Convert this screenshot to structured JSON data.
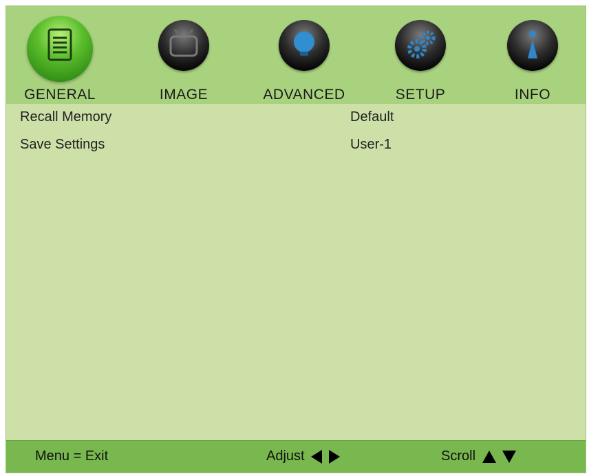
{
  "tabs": [
    {
      "label": "GENERAL",
      "icon": "document-icon",
      "active": true
    },
    {
      "label": "IMAGE",
      "icon": "tv-icon",
      "active": false
    },
    {
      "label": "ADVANCED",
      "icon": "lightbulb-icon",
      "active": false
    },
    {
      "label": "SETUP",
      "icon": "gears-icon",
      "active": false
    },
    {
      "label": "INFO",
      "icon": "info-icon",
      "active": false
    }
  ],
  "menu": {
    "items": [
      {
        "label": "Recall Memory",
        "value": "Default"
      },
      {
        "label": "Save Settings",
        "value": "User-1"
      }
    ]
  },
  "footer": {
    "menu_hint": "Menu = Exit",
    "adjust_hint": "Adjust",
    "scroll_hint": "Scroll"
  },
  "colors": {
    "tabbar_bg": "#a9d27f",
    "panel_bg": "#cde0a8",
    "footer_bg": "#78b84f",
    "active_orb": "#5bbd2c"
  }
}
